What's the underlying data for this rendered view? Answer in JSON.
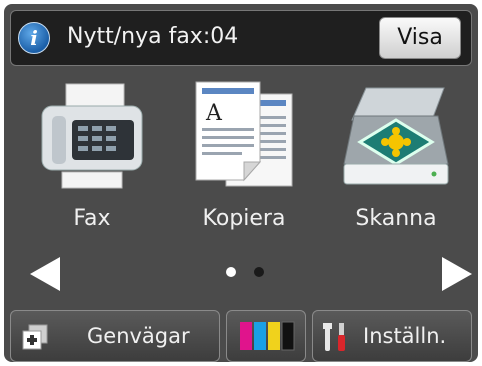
{
  "notification": {
    "icon": "info-icon",
    "info_glyph": "i",
    "message": "Nytt/nya fax:04",
    "view_button": "Visa"
  },
  "functions": [
    {
      "label": "Fax",
      "icon": "fax-machine-icon"
    },
    {
      "label": "Kopiera",
      "icon": "copy-documents-icon"
    },
    {
      "label": "Skanna",
      "icon": "scanner-icon"
    }
  ],
  "pager": {
    "current_page": 1,
    "total_pages": 2,
    "prev_icon": "arrow-left-icon",
    "next_icon": "arrow-right-icon"
  },
  "bottom_bar": {
    "shortcuts": {
      "label": "Genvägar",
      "icon": "add-shortcut-icon"
    },
    "ink": {
      "icon": "ink-cartridges-icon",
      "colors": [
        "#e0148c",
        "#1aa0e6",
        "#f0d21c",
        "#111111"
      ]
    },
    "settings": {
      "label": "Inställn.",
      "icon": "tools-icon"
    }
  }
}
